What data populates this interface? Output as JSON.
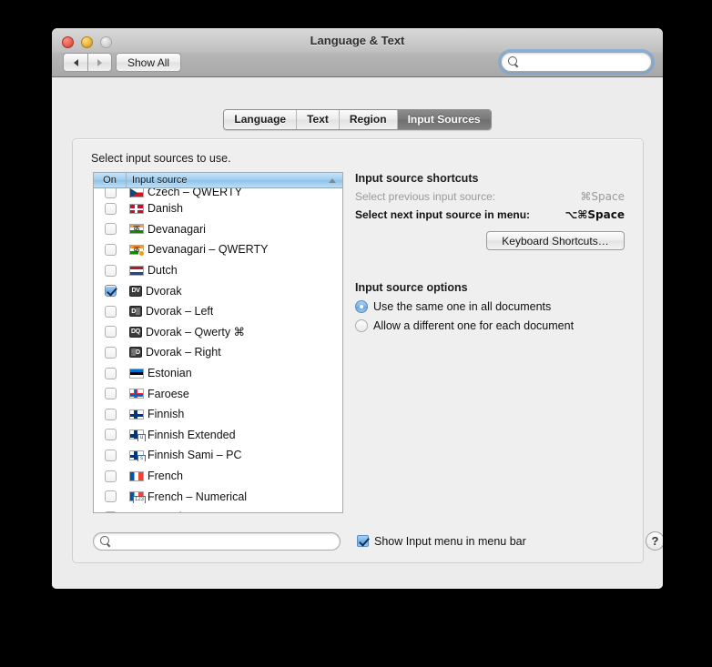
{
  "window": {
    "title": "Language & Text",
    "traffic_lights": [
      "close-button",
      "minimize-button",
      "zoom-button"
    ],
    "nav_back": "◀",
    "nav_forward": "▶",
    "show_all_label": "Show All",
    "search": {
      "value": "",
      "placeholder": "",
      "clear_label": "×"
    }
  },
  "tabs": [
    {
      "label": "Language",
      "active": false
    },
    {
      "label": "Text",
      "active": false
    },
    {
      "label": "Region",
      "active": false
    },
    {
      "label": "Input Sources",
      "active": true
    }
  ],
  "panel": {
    "instruction": "Select input sources to use.",
    "list": {
      "columns": {
        "on": "On",
        "source": "Input source"
      },
      "sort": "ascending",
      "rows": [
        {
          "name": "Czech – QWERTY",
          "checked": false,
          "clipped": true,
          "icon": "flag-czech",
          "badge": ""
        },
        {
          "name": "Danish",
          "checked": false,
          "clipped": false,
          "icon": "flag-denmark",
          "badge": ""
        },
        {
          "name": "Devanagari",
          "checked": false,
          "clipped": false,
          "icon": "flag-india",
          "badge": ""
        },
        {
          "name": "Devanagari – QWERTY",
          "checked": false,
          "clipped": false,
          "icon": "flag-india",
          "badge": "dot-orange"
        },
        {
          "name": "Dutch",
          "checked": false,
          "clipped": false,
          "icon": "flag-netherlands",
          "badge": ""
        },
        {
          "name": "Dvorak",
          "checked": true,
          "clipped": false,
          "icon": "keyboard-badge",
          "badge": "DV"
        },
        {
          "name": "Dvorak – Left",
          "checked": false,
          "clipped": false,
          "icon": "keyboard-badge",
          "badge": "D▒"
        },
        {
          "name": "Dvorak – Qwerty ⌘",
          "checked": false,
          "clipped": false,
          "icon": "keyboard-badge",
          "badge": "DQ"
        },
        {
          "name": "Dvorak – Right",
          "checked": false,
          "clipped": false,
          "icon": "keyboard-badge",
          "badge": "▒D"
        },
        {
          "name": "Estonian",
          "checked": false,
          "clipped": false,
          "icon": "flag-estonia",
          "badge": ""
        },
        {
          "name": "Faroese",
          "checked": false,
          "clipped": false,
          "icon": "flag-faroe",
          "badge": ""
        },
        {
          "name": "Finnish",
          "checked": false,
          "clipped": false,
          "icon": "flag-finland",
          "badge": ""
        },
        {
          "name": "Finnish Extended",
          "checked": false,
          "clipped": false,
          "icon": "flag-finland",
          "badge": "tag-u"
        },
        {
          "name": "Finnish Sami – PC",
          "checked": false,
          "clipped": false,
          "icon": "flag-finland",
          "badge": "tag-s"
        },
        {
          "name": "French",
          "checked": false,
          "clipped": false,
          "icon": "flag-france",
          "badge": ""
        },
        {
          "name": "French – Numerical",
          "checked": false,
          "clipped": false,
          "icon": "flag-france",
          "badge": "tag-123"
        },
        {
          "name": "Georgian – QWERTY",
          "checked": false,
          "clipped": false,
          "icon": "flag-georgia",
          "badge": "dot-red"
        }
      ]
    },
    "shortcuts": {
      "heading": "Input source shortcuts",
      "items": [
        {
          "label": "Select previous input source:",
          "key": "⌘Space",
          "enabled": false
        },
        {
          "label": "Select next input source in menu:",
          "key": "⌥⌘Space",
          "enabled": true
        }
      ],
      "button_label": "Keyboard Shortcuts…"
    },
    "options": {
      "heading": "Input source options",
      "items": [
        {
          "label": "Use the same one in all documents",
          "selected": true
        },
        {
          "label": "Allow a different one for each document",
          "selected": false
        }
      ]
    }
  },
  "bottom": {
    "search": {
      "value": "",
      "placeholder": ""
    },
    "show_input_menu_label": "Show Input menu in menu bar",
    "show_input_menu_checked": true,
    "help_label": "?"
  },
  "colors": {
    "accent_blue": "#7fb4e6",
    "header_blue": "#9ecdf0",
    "window_bg": "#ececec",
    "panel_bg": "#efefef",
    "active_tab_bg": "#787878",
    "disabled_text": "#9a9a9a"
  }
}
